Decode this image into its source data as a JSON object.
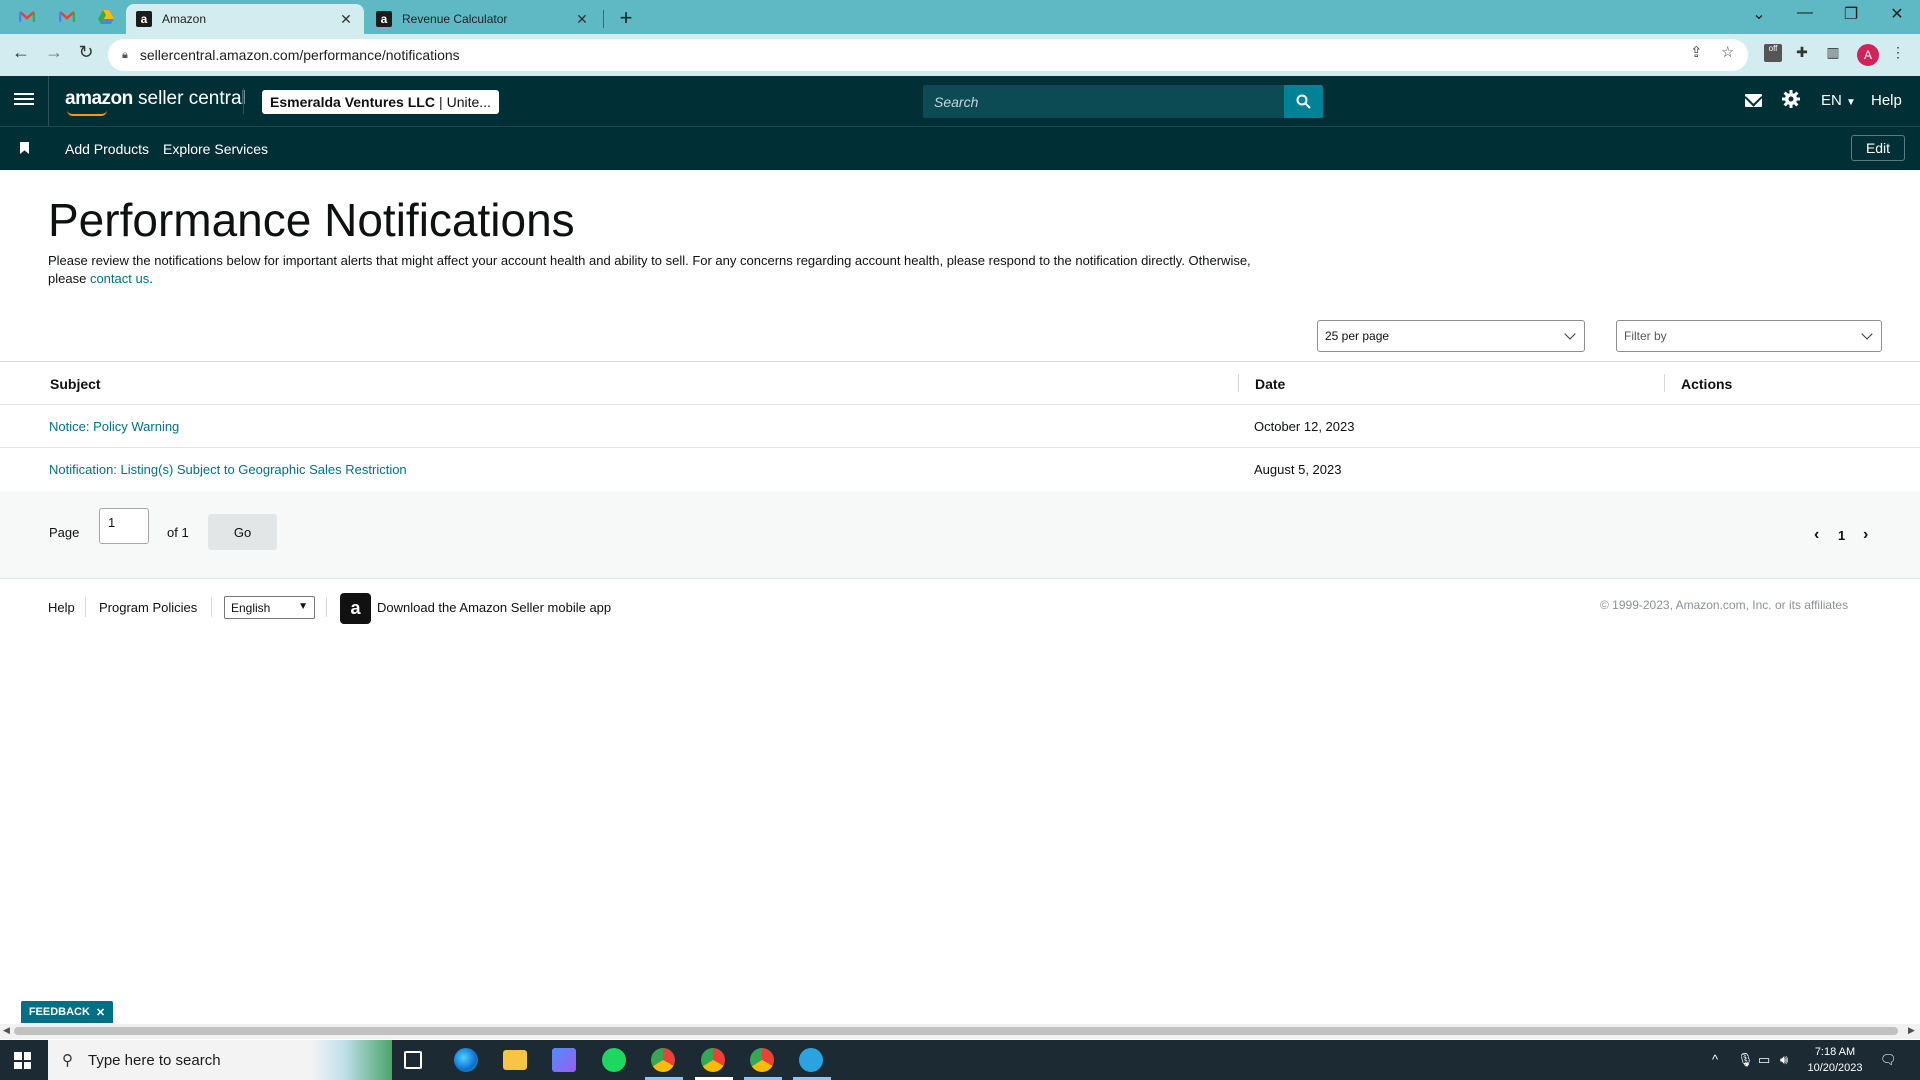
{
  "browser": {
    "tabs": [
      {
        "title": "Amazon",
        "active": true
      },
      {
        "title": "Revenue Calculator",
        "active": false
      }
    ],
    "url": "sellercentral.amazon.com/performance/notifications",
    "profile_initial": "A"
  },
  "header": {
    "logo_brand": "amazon",
    "logo_product": "seller central",
    "account_name": "Esmeralda Ventures LLC",
    "account_region": "Unite...",
    "search_placeholder": "Search",
    "language": "EN",
    "help": "Help"
  },
  "subnav": {
    "links": [
      "Add Products",
      "Explore Services"
    ],
    "edit": "Edit"
  },
  "page": {
    "title": "Performance Notifications",
    "intro": "Please review the notifications below for important alerts that might affect your account health and ability to sell. For any concerns regarding account health, please respond to the notification directly. Otherwise, please",
    "contact_link": "contact us",
    "per_page": "25 per page",
    "filter_placeholder": "Filter by"
  },
  "table": {
    "columns": [
      "Subject",
      "Date",
      "Actions"
    ],
    "rows": [
      {
        "subject": "Notice: Policy Warning",
        "date": "October 12, 2023"
      },
      {
        "subject": "Notification: Listing(s) Subject to Geographic Sales Restriction",
        "date": "August 5, 2023"
      }
    ]
  },
  "pager": {
    "page_label": "Page",
    "page_value": "1",
    "of_label": "of 1",
    "go": "Go",
    "current_page": "1"
  },
  "footer": {
    "help": "Help",
    "program_policies": "Program Policies",
    "language": "English",
    "download_app": "Download the Amazon Seller mobile app",
    "copyright": "© 1999-2023, Amazon.com, Inc. or its affiliates"
  },
  "feedback": "FEEDBACK",
  "taskbar": {
    "search_placeholder": "Type here to search",
    "time": "7:18 AM",
    "date": "10/20/2023"
  },
  "colors": {
    "header_bg": "#002f36",
    "link": "#007185",
    "tabbar": "#5fb9c5"
  }
}
